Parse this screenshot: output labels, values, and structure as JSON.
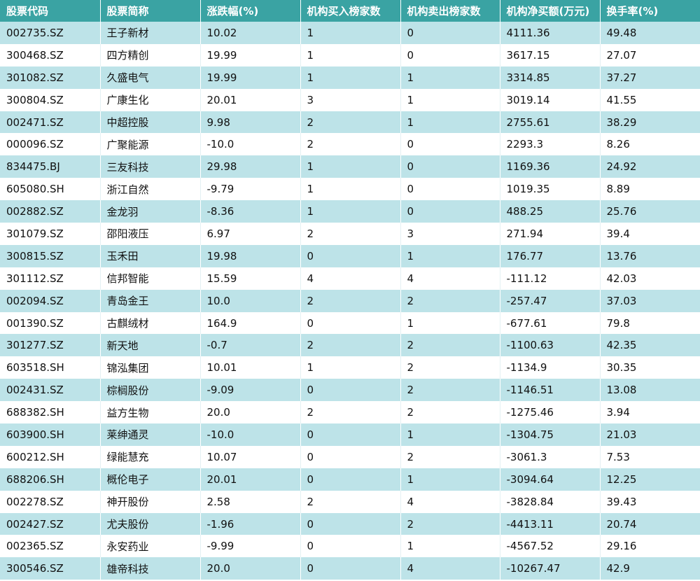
{
  "chart_data": {
    "type": "table",
    "columns": [
      "股票代码",
      "股票简称",
      "涨跌幅(%)",
      "机构买入榜家数",
      "机构卖出榜家数",
      "机构净买额(万元)",
      "换手率(%)"
    ],
    "rows": [
      [
        "002735.SZ",
        "王子新材",
        "10.02",
        "1",
        "0",
        "4111.36",
        "49.48"
      ],
      [
        "300468.SZ",
        "四方精创",
        "19.99",
        "1",
        "0",
        "3617.15",
        "27.07"
      ],
      [
        "301082.SZ",
        "久盛电气",
        "19.99",
        "1",
        "1",
        "3314.85",
        "37.27"
      ],
      [
        "300804.SZ",
        "广康生化",
        "20.01",
        "3",
        "1",
        "3019.14",
        "41.55"
      ],
      [
        "002471.SZ",
        "中超控股",
        "9.98",
        "2",
        "1",
        "2755.61",
        "38.29"
      ],
      [
        "000096.SZ",
        "广聚能源",
        "-10.0",
        "2",
        "0",
        "2293.3",
        "8.26"
      ],
      [
        "834475.BJ",
        "三友科技",
        "29.98",
        "1",
        "0",
        "1169.36",
        "24.92"
      ],
      [
        "605080.SH",
        "浙江自然",
        "-9.79",
        "1",
        "0",
        "1019.35",
        "8.89"
      ],
      [
        "002882.SZ",
        "金龙羽",
        "-8.36",
        "1",
        "0",
        "488.25",
        "25.76"
      ],
      [
        "301079.SZ",
        "邵阳液压",
        "6.97",
        "2",
        "3",
        "271.94",
        "39.4"
      ],
      [
        "300815.SZ",
        "玉禾田",
        "19.98",
        "0",
        "1",
        "176.77",
        "13.76"
      ],
      [
        "301112.SZ",
        "信邦智能",
        "15.59",
        "4",
        "4",
        "-111.12",
        "42.03"
      ],
      [
        "002094.SZ",
        "青岛金王",
        "10.0",
        "2",
        "2",
        "-257.47",
        "37.03"
      ],
      [
        "001390.SZ",
        "古麒绒材",
        "164.9",
        "0",
        "1",
        "-677.61",
        "79.8"
      ],
      [
        "301277.SZ",
        "新天地",
        "-0.7",
        "2",
        "2",
        "-1100.63",
        "42.35"
      ],
      [
        "603518.SH",
        "锦泓集团",
        "10.01",
        "1",
        "2",
        "-1134.9",
        "30.35"
      ],
      [
        "002431.SZ",
        "棕榈股份",
        "-9.09",
        "0",
        "2",
        "-1146.51",
        "13.08"
      ],
      [
        "688382.SH",
        "益方生物",
        "20.0",
        "2",
        "2",
        "-1275.46",
        "3.94"
      ],
      [
        "603900.SH",
        "莱绅通灵",
        "-10.0",
        "0",
        "1",
        "-1304.75",
        "21.03"
      ],
      [
        "600212.SH",
        "绿能慧充",
        "10.07",
        "0",
        "2",
        "-3061.3",
        "7.53"
      ],
      [
        "688206.SH",
        "概伦电子",
        "20.01",
        "0",
        "1",
        "-3094.64",
        "12.25"
      ],
      [
        "002278.SZ",
        "神开股份",
        "2.58",
        "2",
        "4",
        "-3828.84",
        "39.43"
      ],
      [
        "002427.SZ",
        "尤夫股份",
        "-1.96",
        "0",
        "2",
        "-4413.11",
        "20.74"
      ],
      [
        "002365.SZ",
        "永安药业",
        "-9.99",
        "0",
        "1",
        "-4567.52",
        "29.16"
      ],
      [
        "300546.SZ",
        "雄帝科技",
        "20.0",
        "0",
        "4",
        "-10267.47",
        "42.9"
      ]
    ],
    "header_color": "#3aa3a3",
    "stripe_color": "#bde3e8"
  }
}
